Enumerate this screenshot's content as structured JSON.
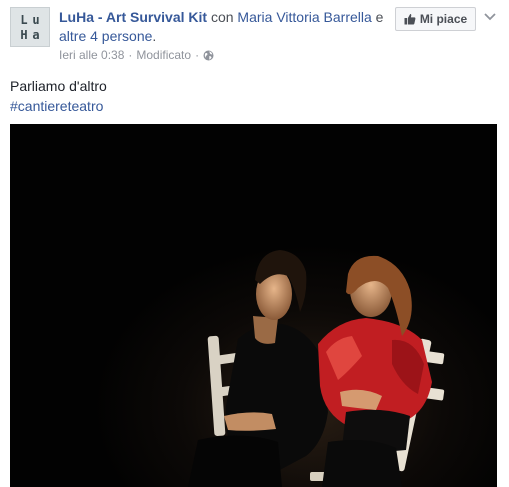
{
  "header": {
    "author": "LuHa - Art Survival Kit",
    "with_word": " con ",
    "tagged_person": "Maria Vittoria Barrella",
    "and_word": " e ",
    "others": "altre 4 persone",
    "period": "."
  },
  "avatar": {
    "letters": [
      "L",
      "u",
      "H",
      "a"
    ]
  },
  "meta": {
    "time": "Ieri alle 0:38",
    "separator": "·",
    "edited": "Modificato",
    "separator2": "·",
    "privacy_icon": "globe-icon"
  },
  "actions": {
    "like_label": "Mi piace",
    "like_icon": "thumbs-up-icon",
    "menu_icon": "chevron-down-icon"
  },
  "post": {
    "text": "Parliamo d'altro",
    "hashtag": "#cantiereteatro"
  },
  "colors": {
    "link": "#365899",
    "muted": "#90949c",
    "text": "#1d2129",
    "photo_bg": "#020202"
  }
}
